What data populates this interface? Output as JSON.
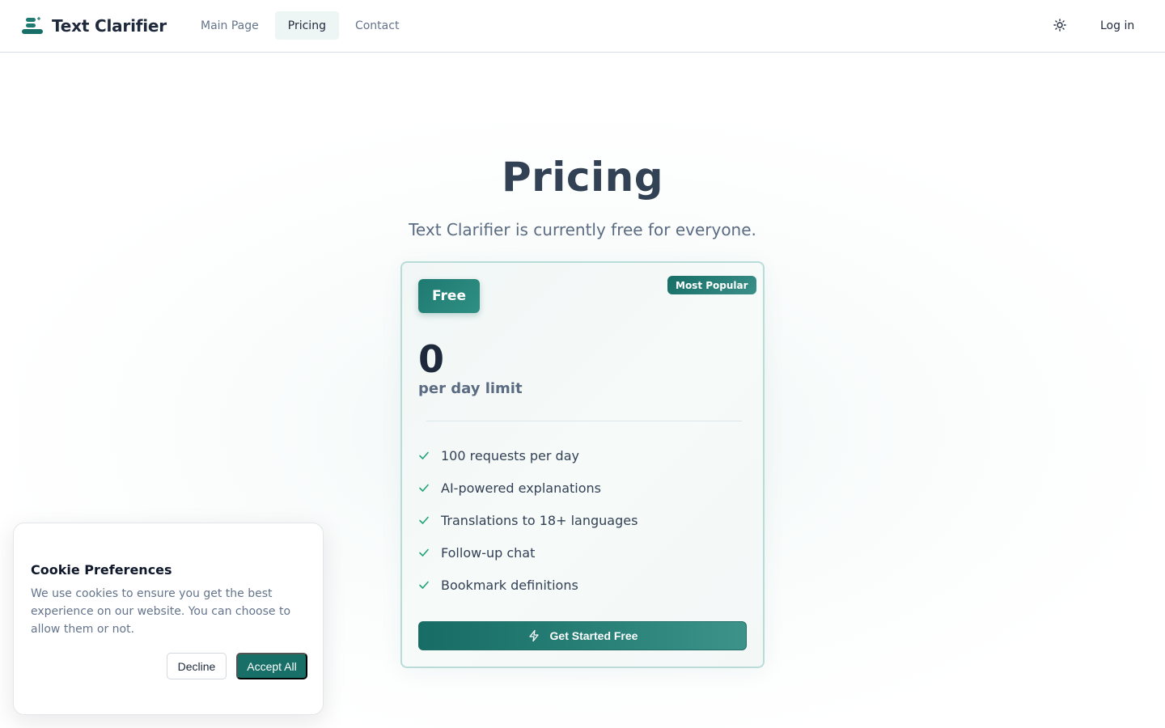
{
  "header": {
    "brand_name": "Text Clarifier",
    "logo_icon": "stacked-lines-logo",
    "nav": [
      {
        "label": "Main Page",
        "active": false
      },
      {
        "label": "Pricing",
        "active": true
      },
      {
        "label": "Contact",
        "active": false
      }
    ],
    "theme_icon": "sun-icon",
    "login_label": "Log in"
  },
  "hero": {
    "title": "Pricing",
    "subtitle": "Text Clarifier is currently free for everyone."
  },
  "plan": {
    "tier": "Free",
    "badge": "Most Popular",
    "price": "0",
    "price_unit": "per day limit",
    "features": [
      "100 requests per day",
      "AI-powered explanations",
      "Translations to 18+ languages",
      "Follow-up chat",
      "Bookmark definitions"
    ],
    "feature_icon": "check-icon",
    "cta_label": "Get Started Free",
    "cta_icon": "lightning-icon"
  },
  "cookie": {
    "title": "Cookie Preferences",
    "text": "We use cookies to ensure you get the best experience on our website. You can choose to allow them or not.",
    "decline_label": "Decline",
    "accept_label": "Accept All"
  },
  "colors": {
    "accent": "#186f67",
    "accent_light": "#2f8f83",
    "check": "#22a37a"
  }
}
